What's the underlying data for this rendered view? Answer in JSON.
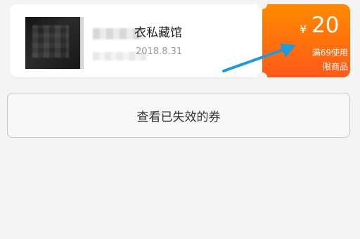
{
  "coupon": {
    "shop_name": "衣私藏馆",
    "date": "2018.8.31",
    "currency": "¥",
    "amount": "20",
    "condition": "满69使用",
    "scope": "限商品"
  },
  "actions": {
    "view_expired": "查看已失效的券"
  },
  "colors": {
    "ticket_orange": "#ff7a00",
    "arrow_blue": "#1e9be0"
  }
}
